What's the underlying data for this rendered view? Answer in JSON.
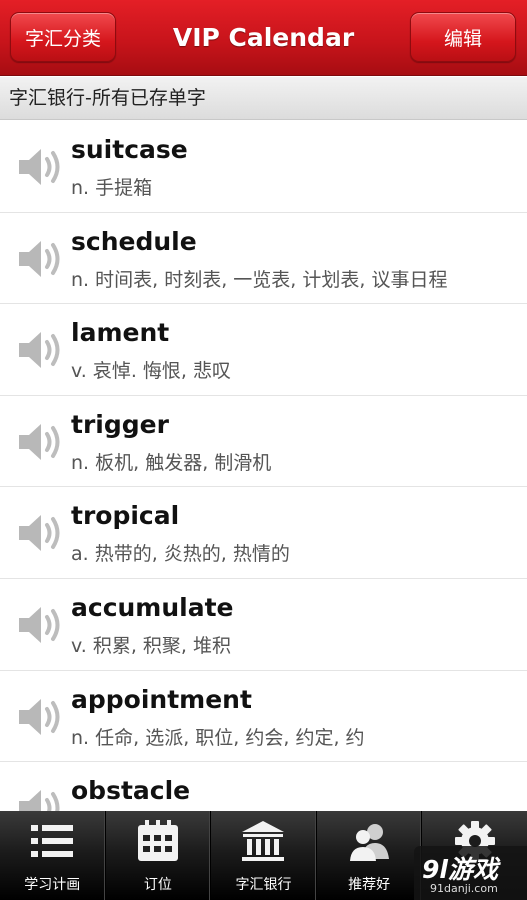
{
  "header": {
    "left_button": "字汇分类",
    "title": "VIP Calendar",
    "right_button": "编辑"
  },
  "subheader": "字汇银行-所有已存单字",
  "words": [
    {
      "word": "suitcase",
      "definition": "n. 手提箱"
    },
    {
      "word": "schedule",
      "definition": "n. 时间表, 时刻表, 一览表, 计划表, 议事日程"
    },
    {
      "word": "lament",
      "definition": "v. 哀悼. 悔恨, 悲叹"
    },
    {
      "word": "trigger",
      "definition": "n. 板机, 触发器, 制滑机"
    },
    {
      "word": "tropical",
      "definition": "a. 热带的, 炎热的, 热情的"
    },
    {
      "word": "accumulate",
      "definition": "v. 积累, 积聚, 堆积"
    },
    {
      "word": "appointment",
      "definition": "n. 任命, 选派, 职位, 约会, 约定, 约"
    },
    {
      "word": "obstacle",
      "definition": ""
    }
  ],
  "tabs": [
    {
      "label": "学习计画",
      "icon": "list-icon"
    },
    {
      "label": "订位",
      "icon": "calendar-icon"
    },
    {
      "label": "字汇银行",
      "icon": "bank-icon"
    },
    {
      "label": "推荐好",
      "icon": "users-icon"
    },
    {
      "label": "",
      "icon": "gear-icon"
    }
  ],
  "watermark": {
    "logo": "9l游戏",
    "url": "91danji.com"
  },
  "colors": {
    "header_red": "#d5161c",
    "tabbar": "#1c1c1c"
  }
}
